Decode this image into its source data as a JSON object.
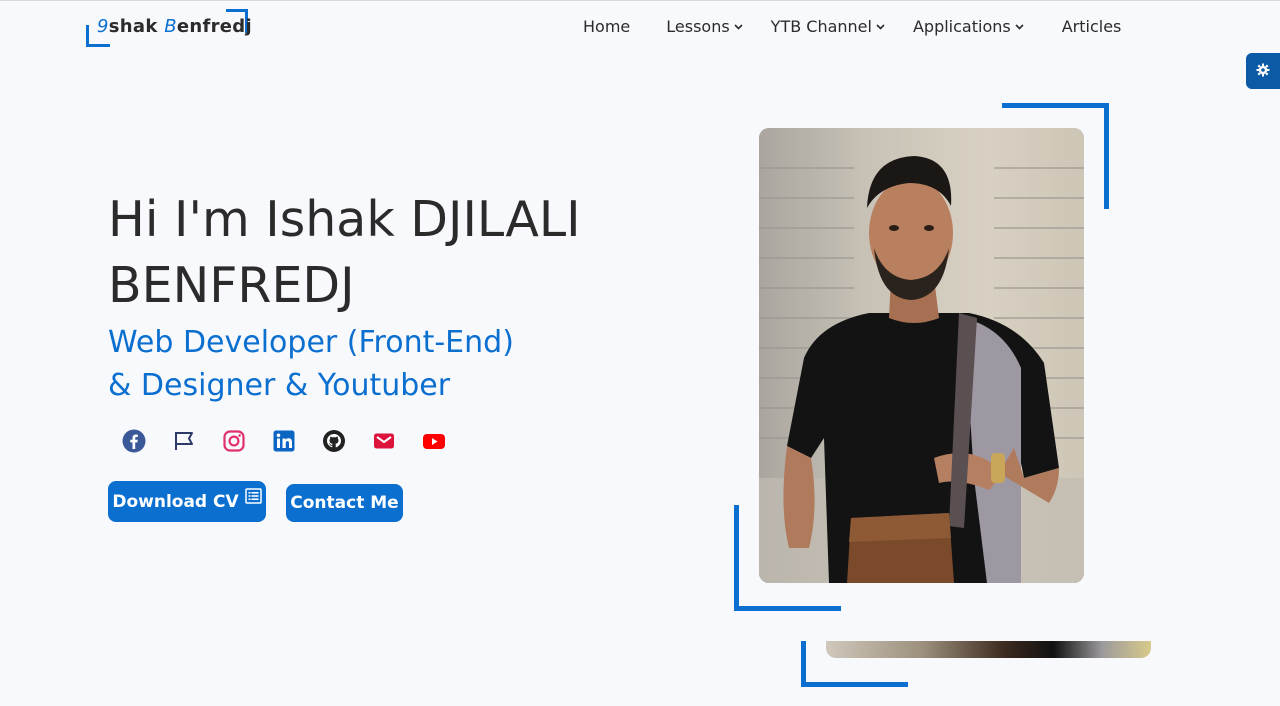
{
  "logo": {
    "first_letter": "9",
    "word1": "shak ",
    "second_letter": "B",
    "word2": "enfredj"
  },
  "nav": {
    "home": "Home",
    "lessons": "Lessons",
    "ytb": "YTB Channel",
    "applications": "Applications",
    "articles": "Articles"
  },
  "hero": {
    "title": "Hi I'm Ishak DJILALI BENFREDJ",
    "subtitle_line1": "Web Developer (Front-End)",
    "subtitle_line2": "& Designer & Youtuber"
  },
  "socials": [
    {
      "icon": "facebook-icon",
      "color": "#3b5998"
    },
    {
      "icon": "flag-icon",
      "color": "#2b3a67"
    },
    {
      "icon": "instagram-icon",
      "color": "#e1306c"
    },
    {
      "icon": "linkedin-icon",
      "color": "#0a66c2"
    },
    {
      "icon": "github-icon",
      "color": "#222222"
    },
    {
      "icon": "mail-icon",
      "color": "#dc143c"
    },
    {
      "icon": "youtube-icon",
      "color": "#ff0000"
    }
  ],
  "buttons": {
    "download_cv": "Download CV",
    "contact_me": "Contact Me"
  },
  "colors": {
    "accent": "#0b6fd0",
    "background": "#f8f9fd",
    "text": "#2b2b2b"
  }
}
